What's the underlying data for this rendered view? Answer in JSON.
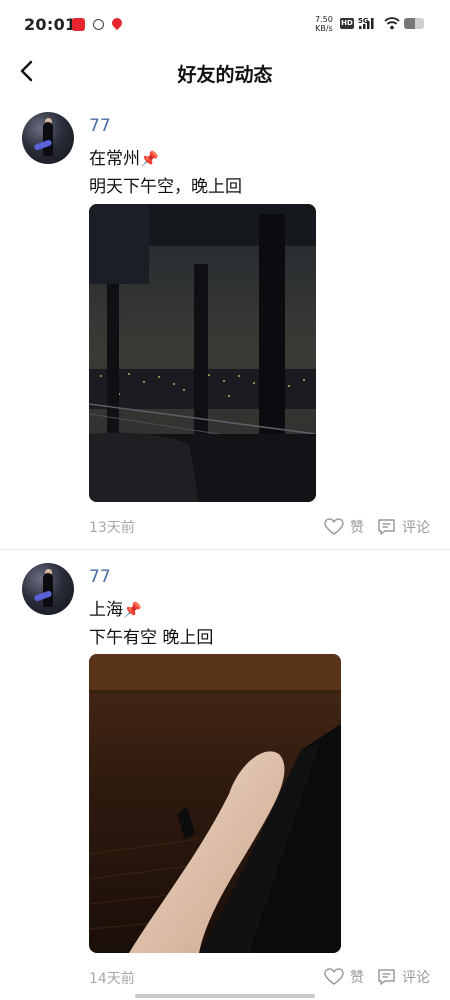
{
  "status_bar": {
    "time": "20:01",
    "net_speed_value": "7.50",
    "net_speed_unit": "KB/s",
    "hd": "HD",
    "network": "5G",
    "battery_level": 0.55
  },
  "header": {
    "title": "好友的动态"
  },
  "posts": [
    {
      "username": "77",
      "line1": "在常州",
      "line1_icon": "pushpin-icon",
      "line2": "明天下午空，晚上回",
      "time": "13天前",
      "like_label": "赞",
      "comment_label": "评论"
    },
    {
      "username": "77",
      "line1": "上海",
      "line1_icon": "pushpin-icon",
      "line2": "下午有空 晚上回",
      "time": "14天前",
      "like_label": "赞",
      "comment_label": "评论"
    }
  ],
  "colors": {
    "username": "#4a6ea8",
    "muted": "#a8a8a8",
    "pin": "#e23b3b"
  }
}
